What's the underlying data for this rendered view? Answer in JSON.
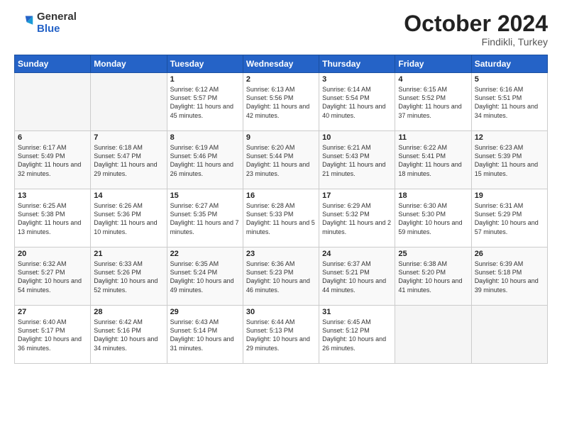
{
  "header": {
    "logo_general": "General",
    "logo_blue": "Blue",
    "month_title": "October 2024",
    "location": "Findikli, Turkey"
  },
  "weekdays": [
    "Sunday",
    "Monday",
    "Tuesday",
    "Wednesday",
    "Thursday",
    "Friday",
    "Saturday"
  ],
  "weeks": [
    [
      {
        "day": "",
        "empty": true
      },
      {
        "day": "",
        "empty": true
      },
      {
        "day": "1",
        "sunrise": "6:12 AM",
        "sunset": "5:57 PM",
        "daylight": "11 hours and 45 minutes."
      },
      {
        "day": "2",
        "sunrise": "6:13 AM",
        "sunset": "5:56 PM",
        "daylight": "11 hours and 42 minutes."
      },
      {
        "day": "3",
        "sunrise": "6:14 AM",
        "sunset": "5:54 PM",
        "daylight": "11 hours and 40 minutes."
      },
      {
        "day": "4",
        "sunrise": "6:15 AM",
        "sunset": "5:52 PM",
        "daylight": "11 hours and 37 minutes."
      },
      {
        "day": "5",
        "sunrise": "6:16 AM",
        "sunset": "5:51 PM",
        "daylight": "11 hours and 34 minutes."
      }
    ],
    [
      {
        "day": "6",
        "sunrise": "6:17 AM",
        "sunset": "5:49 PM",
        "daylight": "11 hours and 32 minutes."
      },
      {
        "day": "7",
        "sunrise": "6:18 AM",
        "sunset": "5:47 PM",
        "daylight": "11 hours and 29 minutes."
      },
      {
        "day": "8",
        "sunrise": "6:19 AM",
        "sunset": "5:46 PM",
        "daylight": "11 hours and 26 minutes."
      },
      {
        "day": "9",
        "sunrise": "6:20 AM",
        "sunset": "5:44 PM",
        "daylight": "11 hours and 23 minutes."
      },
      {
        "day": "10",
        "sunrise": "6:21 AM",
        "sunset": "5:43 PM",
        "daylight": "11 hours and 21 minutes."
      },
      {
        "day": "11",
        "sunrise": "6:22 AM",
        "sunset": "5:41 PM",
        "daylight": "11 hours and 18 minutes."
      },
      {
        "day": "12",
        "sunrise": "6:23 AM",
        "sunset": "5:39 PM",
        "daylight": "11 hours and 15 minutes."
      }
    ],
    [
      {
        "day": "13",
        "sunrise": "6:25 AM",
        "sunset": "5:38 PM",
        "daylight": "11 hours and 13 minutes."
      },
      {
        "day": "14",
        "sunrise": "6:26 AM",
        "sunset": "5:36 PM",
        "daylight": "11 hours and 10 minutes."
      },
      {
        "day": "15",
        "sunrise": "6:27 AM",
        "sunset": "5:35 PM",
        "daylight": "11 hours and 7 minutes."
      },
      {
        "day": "16",
        "sunrise": "6:28 AM",
        "sunset": "5:33 PM",
        "daylight": "11 hours and 5 minutes."
      },
      {
        "day": "17",
        "sunrise": "6:29 AM",
        "sunset": "5:32 PM",
        "daylight": "11 hours and 2 minutes."
      },
      {
        "day": "18",
        "sunrise": "6:30 AM",
        "sunset": "5:30 PM",
        "daylight": "10 hours and 59 minutes."
      },
      {
        "day": "19",
        "sunrise": "6:31 AM",
        "sunset": "5:29 PM",
        "daylight": "10 hours and 57 minutes."
      }
    ],
    [
      {
        "day": "20",
        "sunrise": "6:32 AM",
        "sunset": "5:27 PM",
        "daylight": "10 hours and 54 minutes."
      },
      {
        "day": "21",
        "sunrise": "6:33 AM",
        "sunset": "5:26 PM",
        "daylight": "10 hours and 52 minutes."
      },
      {
        "day": "22",
        "sunrise": "6:35 AM",
        "sunset": "5:24 PM",
        "daylight": "10 hours and 49 minutes."
      },
      {
        "day": "23",
        "sunrise": "6:36 AM",
        "sunset": "5:23 PM",
        "daylight": "10 hours and 46 minutes."
      },
      {
        "day": "24",
        "sunrise": "6:37 AM",
        "sunset": "5:21 PM",
        "daylight": "10 hours and 44 minutes."
      },
      {
        "day": "25",
        "sunrise": "6:38 AM",
        "sunset": "5:20 PM",
        "daylight": "10 hours and 41 minutes."
      },
      {
        "day": "26",
        "sunrise": "6:39 AM",
        "sunset": "5:18 PM",
        "daylight": "10 hours and 39 minutes."
      }
    ],
    [
      {
        "day": "27",
        "sunrise": "6:40 AM",
        "sunset": "5:17 PM",
        "daylight": "10 hours and 36 minutes."
      },
      {
        "day": "28",
        "sunrise": "6:42 AM",
        "sunset": "5:16 PM",
        "daylight": "10 hours and 34 minutes."
      },
      {
        "day": "29",
        "sunrise": "6:43 AM",
        "sunset": "5:14 PM",
        "daylight": "10 hours and 31 minutes."
      },
      {
        "day": "30",
        "sunrise": "6:44 AM",
        "sunset": "5:13 PM",
        "daylight": "10 hours and 29 minutes."
      },
      {
        "day": "31",
        "sunrise": "6:45 AM",
        "sunset": "5:12 PM",
        "daylight": "10 hours and 26 minutes."
      },
      {
        "day": "",
        "empty": true
      },
      {
        "day": "",
        "empty": true
      }
    ]
  ]
}
